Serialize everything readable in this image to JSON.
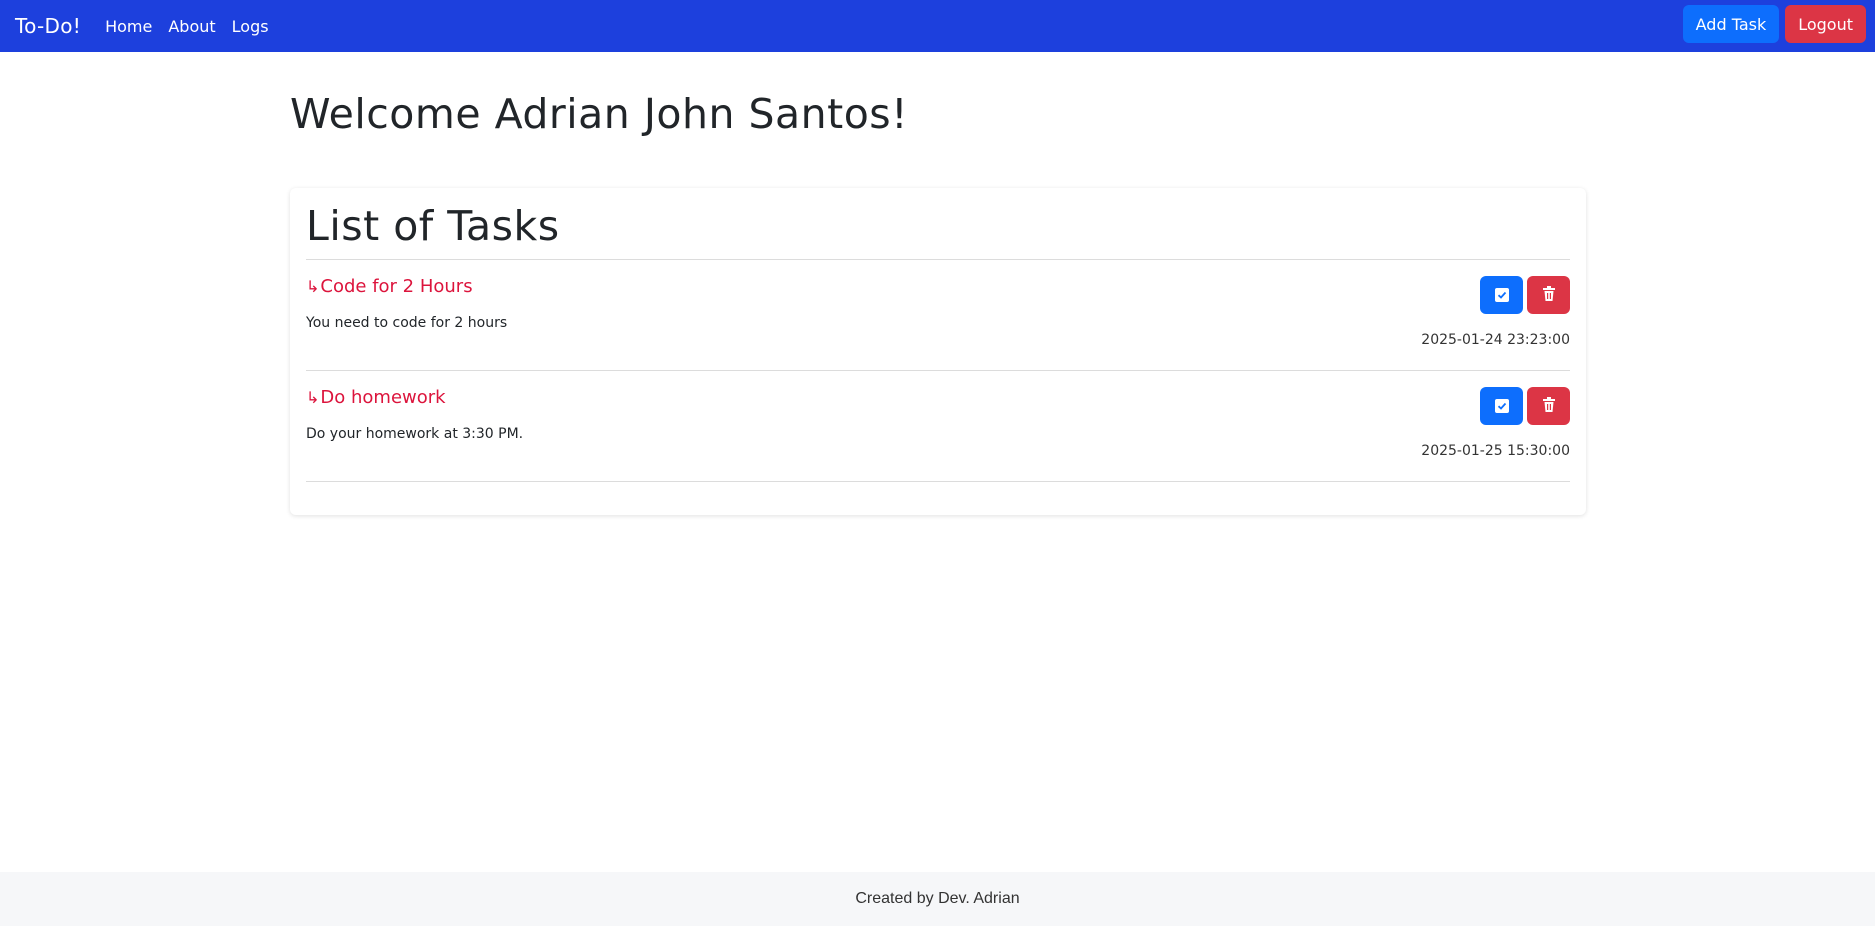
{
  "navbar": {
    "brand": "To-Do!",
    "links": [
      "Home",
      "About",
      "Logs"
    ],
    "add_task_label": "Add Task",
    "logout_label": "Logout",
    "colors": {
      "background": "#1d40dd",
      "primary": "#0d6efd",
      "danger": "#dc3545"
    }
  },
  "main": {
    "welcome": "Welcome Adrian John Santos!",
    "tasks_title": "List of Tasks",
    "tasks": [
      {
        "arrow": "↳",
        "title": "Code for 2 Hours",
        "description": "You need to code for 2 hours",
        "datetime": "2025-01-24 23:23:00",
        "icons": [
          "check-square-icon",
          "trash-icon"
        ]
      },
      {
        "arrow": "↳",
        "title": "Do homework",
        "description": "Do your homework at 3:30 PM.",
        "datetime": "2025-01-25 15:30:00",
        "icons": [
          "check-square-icon",
          "trash-icon"
        ]
      }
    ],
    "title_color": "#dc143c"
  },
  "footer": {
    "text": "Created by Dev. Adrian"
  }
}
